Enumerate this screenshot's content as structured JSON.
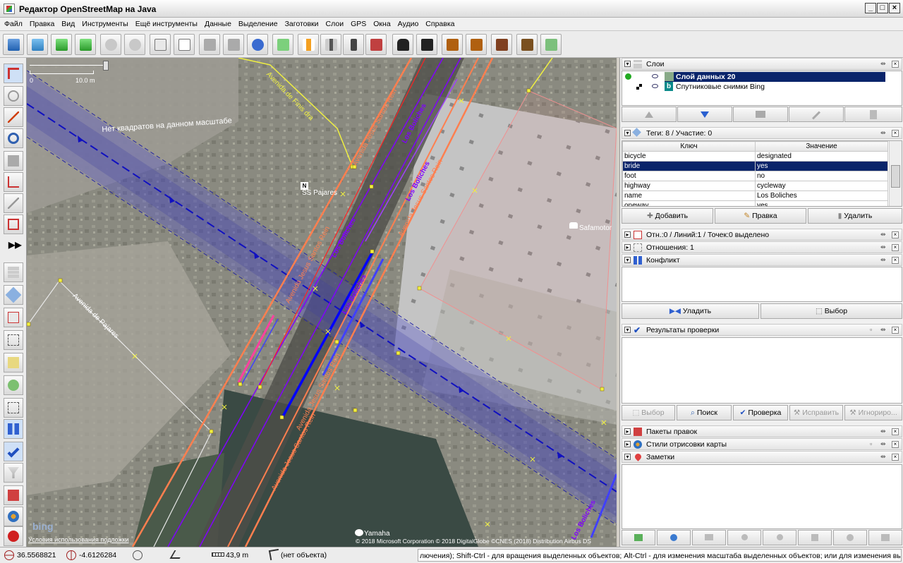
{
  "window": {
    "title": "Редактор OpenStreetMap на Java",
    "controls": {
      "minimize": "_",
      "maximize": "□",
      "close": "×"
    }
  },
  "menu": [
    "Файл",
    "Правка",
    "Вид",
    "Инструменты",
    "Ещё инструменты",
    "Данные",
    "Выделение",
    "Заготовки",
    "Слои",
    "GPS",
    "Окна",
    "Аудио",
    "Справка"
  ],
  "toolbar_icons": [
    "open-icon",
    "save-icon",
    "download-icon",
    "upload-icon",
    "undo-icon",
    "redo-icon",
    "preferences-icon",
    "properties-icon",
    "draw-icon",
    "split-icon",
    "sync-icon",
    "combine-icon",
    "road-icon",
    "rail-icon",
    "traffic-signal-icon",
    "wall-icon",
    "car-icon",
    "bus-icon",
    "warning-icon",
    "restaurant-icon",
    "castle-icon",
    "factory-icon",
    "recycle-icon"
  ],
  "left_tools": [
    "select-tool-icon",
    "lasso-icon",
    "draw-icon",
    "zoom-icon",
    "delete-icon",
    "parallel-icon",
    "improve-way-icon",
    "extrude-icon",
    "expand-icon",
    "layers-icon",
    "tags-icon",
    "relations-icon",
    "select-list-icon",
    "add-node-icon",
    "imagery-icon",
    "history-icon",
    "conflict-icon",
    "validator-icon",
    "filter-icon",
    "changesets-icon",
    "map-style-icon",
    "close-icon"
  ],
  "map": {
    "scale_label": "10.0 m",
    "scale_zero": "0",
    "overlay_text": "Нет квадратов на данном масштабе",
    "labels": {
      "avenida_finisterre": "Avenida de Finis dra",
      "avenida_jesus_1": "Avenida Jesus Santos Rein",
      "avenida_jesus_2": "Avenida Jesus Santos Rein",
      "avenida_jesus_3": "Avenida Jesus Santos Rein",
      "avenida_jesus_4": "Avenida Jesus Santos Rein",
      "avenida_jesus_5": "Avenida Jesus Santos Rein",
      "los_boliches_1": "Los Boliches",
      "los_boliches_2": "Los Boliches",
      "los_boliches_3": "Los Boliches",
      "los_boliches_4": "Los Boliches",
      "los_boliches_5": "Los Boliches",
      "avenida_pajares": "Avenida de Pajares",
      "ss_pajares": "SS Pajares",
      "safamotor": "Safamotor",
      "yamaha": "Yamaha",
      "bing_logo": "bing",
      "terms": "Условия использования подложки",
      "copyright": "© 2018 Microsoft Corporation © 2018 DigitalGlobe ©CNES (2018) Distribution Airbus DS"
    }
  },
  "layers_panel": {
    "title": "Слои",
    "layers": [
      {
        "name": "Слой данных 20",
        "active": true
      },
      {
        "name": "Спутниковые снимки Bing",
        "active": false
      }
    ]
  },
  "tags_panel": {
    "title": "Теги: 8 / Участие: 0",
    "columns": [
      "Ключ",
      "Значение"
    ],
    "rows": [
      [
        "bicycle",
        "designated"
      ],
      [
        "bride",
        "yes"
      ],
      [
        "foot",
        "no"
      ],
      [
        "highway",
        "cycleway"
      ],
      [
        "name",
        "Los Boliches"
      ],
      [
        "oneway",
        "yes"
      ]
    ],
    "selected_row": 1,
    "buttons": {
      "add": "Добавить",
      "edit": "Правка",
      "delete": "Удалить"
    }
  },
  "selection_panel": {
    "title": "Отн.:0 / Линий:1 / Точек:0 выделено"
  },
  "relations_panel": {
    "title": "Отношения: 1"
  },
  "conflict_panel": {
    "title": "Конфликт",
    "buttons": {
      "resolve": "Уладить",
      "select": "Выбор"
    }
  },
  "validation_panel": {
    "title": "Результаты проверки",
    "buttons": {
      "select": "Выбор",
      "lookup": "Поиск",
      "validate": "Проверка",
      "fix": "Исправить",
      "ignore": "Игнориро..."
    }
  },
  "changesets_panel": {
    "title": "Пакеты правок"
  },
  "mapstyles_panel": {
    "title": "Стили отрисовки карты"
  },
  "notes_panel": {
    "title": "Заметки"
  },
  "status": {
    "lat": "36.5568821",
    "lon": "-4.6126284",
    "length": "43,9 m",
    "object": "(нет объекта)",
    "help": "лючения); Shift-Ctrl - для вращения выделенных объектов; Alt-Ctrl - для изменения масштаба выделенных объектов; или для изменения выделения"
  },
  "colors": {
    "accent": "#0a246a",
    "road": "#ff7f4f",
    "cycleway": "#8000ff",
    "selected_way": "#ff0000",
    "overlay": "#5050d0"
  }
}
